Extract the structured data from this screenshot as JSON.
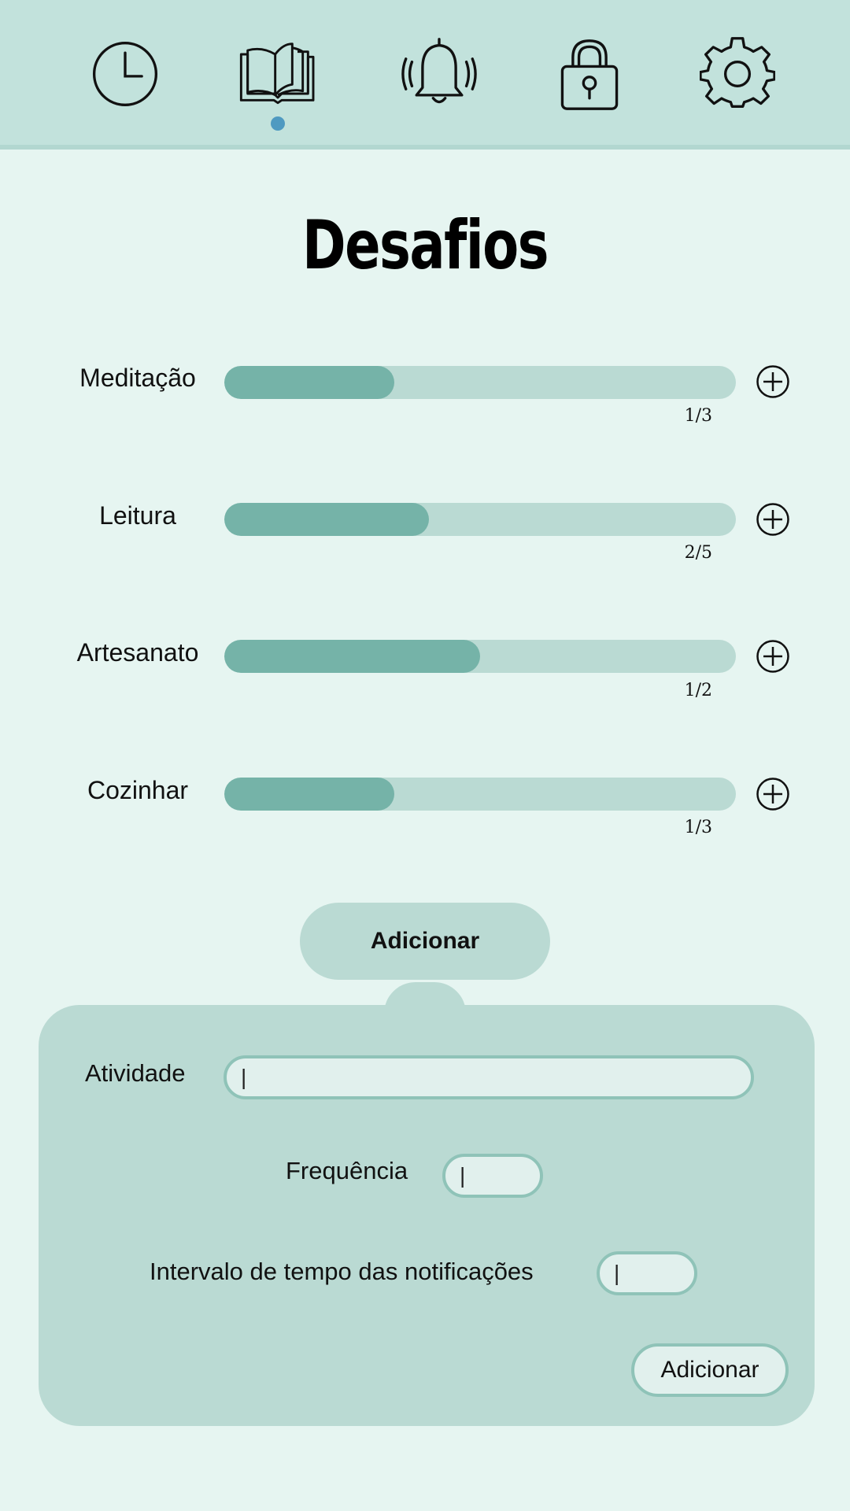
{
  "nav": {
    "items": [
      {
        "icon": "clock-icon",
        "active": false
      },
      {
        "icon": "book-icon",
        "active": true
      },
      {
        "icon": "bell-icon",
        "active": false
      },
      {
        "icon": "lock-icon",
        "active": false
      },
      {
        "icon": "gear-icon",
        "active": false
      }
    ],
    "active_color": "#4f9ac1"
  },
  "page": {
    "title": "Desafios"
  },
  "challenges": [
    {
      "label": "Meditação",
      "count": "1/3",
      "progress": 0.333
    },
    {
      "label": "Leitura",
      "count": "2/5",
      "progress": 0.4
    },
    {
      "label": "Artesanato",
      "count": "1/2",
      "progress": 0.5
    },
    {
      "label": "Cozinhar",
      "count": "1/3",
      "progress": 0.333
    }
  ],
  "add_toggle": {
    "label": "Adicionar"
  },
  "form": {
    "activity_label": "Atividade",
    "activity_value": "|",
    "frequency_label": "Frequência",
    "frequency_value": "|",
    "interval_label": "Intervalo de tempo das notificações",
    "interval_value": "|",
    "submit_label": "Adicionar"
  },
  "colors": {
    "topbar": "#c2e2dc",
    "background": "#e6f5f1",
    "track": "#badad3",
    "fill": "#75b3a8",
    "panel": "#badad3"
  }
}
